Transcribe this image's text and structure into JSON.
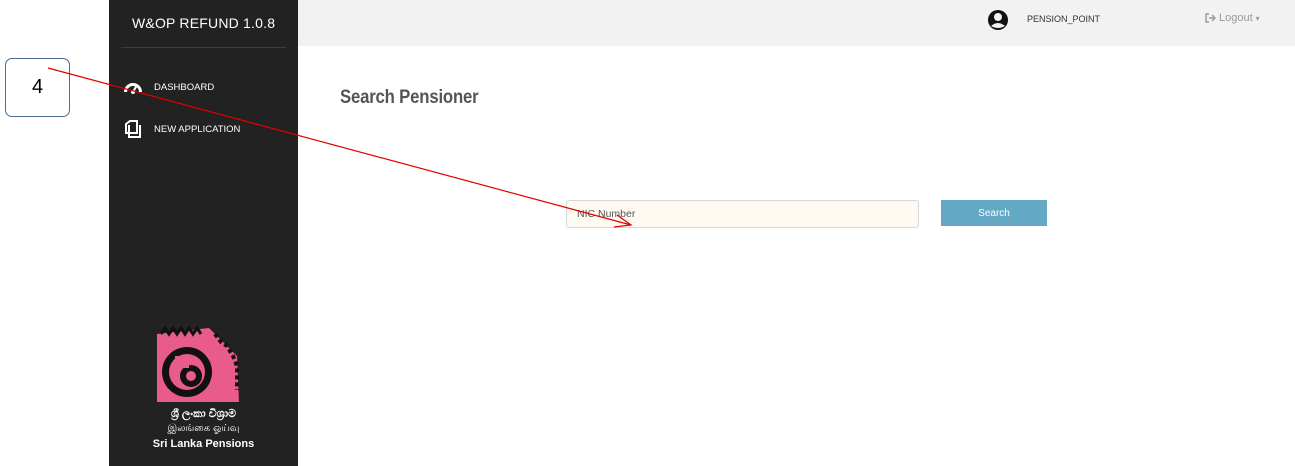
{
  "app": {
    "title": "W&OP REFUND 1.0.8"
  },
  "sidebar": {
    "items": [
      {
        "label": "DASHBOARD",
        "icon": "dashboard-gauge-icon"
      },
      {
        "label": "NEW APPLICATION",
        "icon": "document-copy-icon"
      }
    ],
    "logo": {
      "sinhala": "ශ්‍රී ලංකා විශ්‍රාම",
      "tamil": "இலங்கை ஓய்வு",
      "english": "Sri Lanka Pensions"
    }
  },
  "topbar": {
    "user_name": "PENSION_POINT",
    "user_icon": "user-circle-icon",
    "logout_label": "Logout",
    "logout_icon": "sign-out-icon"
  },
  "main": {
    "title": "Search Pensioner",
    "nic_placeholder": "NIC Number",
    "nic_value": "",
    "search_label": "Search"
  },
  "annotation": {
    "callout_label": "4"
  },
  "colors": {
    "sidebar_bg": "#222222",
    "topbar_bg": "#f2f2f2",
    "search_button": "#63a9c5",
    "title": "#555555",
    "arrow": "#e00000",
    "logo_pink": "#e85b8a"
  }
}
